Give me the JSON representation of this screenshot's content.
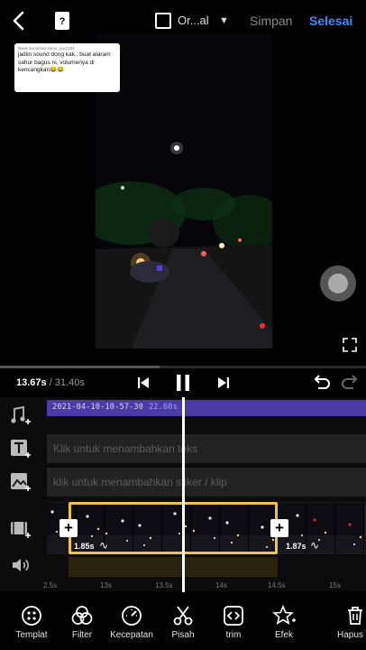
{
  "topbar": {
    "ratio_label": "Or...al",
    "save_label": "Simpan",
    "done_label": "Selesai",
    "help_label": "?"
  },
  "comment": {
    "author": "Balas komentar kamu_pur1234",
    "message": "jadiin sound dong kak.. buat alaram sahur bagus ni, volumenya di kencangkan😂😂"
  },
  "playback": {
    "current_time": "13.67s",
    "total_time": "31.40s",
    "progress": 0.435
  },
  "timeline": {
    "audio_clip": {
      "label": "2021-04-10-10-57-30",
      "duration": "22.60s"
    },
    "text_lane_placeholder": "Klik untuk menambahkan teks",
    "sticker_lane_placeholder": "klik untuk menambahkan stiker / klip",
    "clip_left_duration": "1.85s",
    "clip_right_duration": "1.87s",
    "ticks": [
      "2.5s",
      "13s",
      "13.5s",
      "14s",
      "14.5s",
      "15s"
    ]
  },
  "toolbar": {
    "items": [
      {
        "label": "Templat",
        "icon": "template-icon"
      },
      {
        "label": "Filter",
        "icon": "filter-icon"
      },
      {
        "label": "Kecepatan",
        "icon": "speed-icon"
      },
      {
        "label": "Pisah",
        "icon": "scissors-icon"
      },
      {
        "label": "trim",
        "icon": "trim-icon"
      },
      {
        "label": "Efek",
        "icon": "star-icon"
      },
      {
        "label": "Hapus",
        "icon": "trash-icon"
      }
    ]
  },
  "colors": {
    "accent": "#3a8cff",
    "selection": "#f0c53a",
    "audio": "#4b3aa8"
  }
}
